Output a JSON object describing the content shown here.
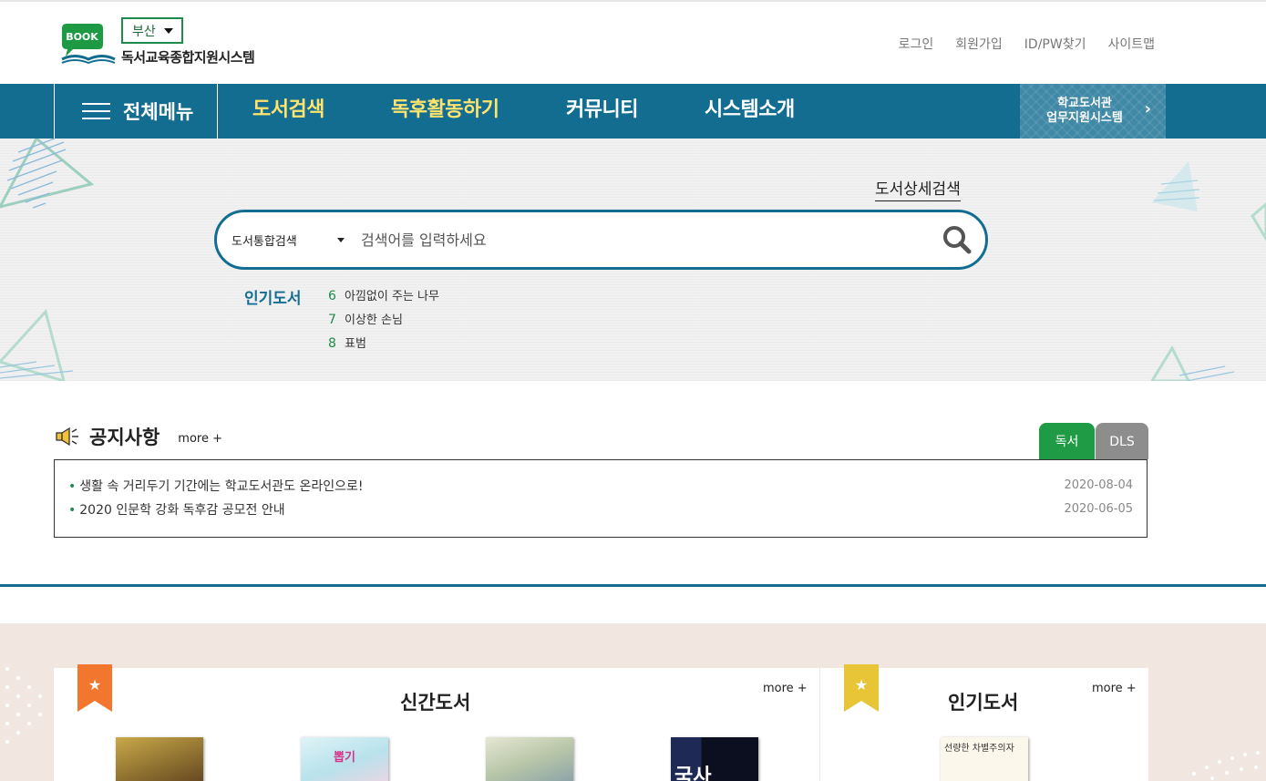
{
  "header": {
    "logo_text": "BOOK",
    "region": "부산",
    "site_name": "독서교육종합지원시스템",
    "links": [
      "로그인",
      "회원가입",
      "ID/PW찾기",
      "사이트맵"
    ]
  },
  "gnb": {
    "all_menu": "전체메뉴",
    "items": [
      "도서검색",
      "독후활동하기",
      "커뮤니티",
      "시스템소개"
    ],
    "school_link": [
      "학교도서관",
      "업무지원시스템"
    ]
  },
  "search": {
    "detail_link": "도서상세검색",
    "scope": "도서통합검색",
    "placeholder": "검색어를 입력하세요",
    "popular_title": "인기도서",
    "popular": [
      {
        "rank": "6",
        "title": "아낌없이 주는 나무"
      },
      {
        "rank": "7",
        "title": "이상한 손님"
      },
      {
        "rank": "8",
        "title": "표범"
      }
    ]
  },
  "notice": {
    "title": "공지사항",
    "more": "more +",
    "tabs": [
      "독서",
      "DLS"
    ],
    "items": [
      {
        "title": "생활 속 거리두기 기간에는 학교도서관도 온라인으로!",
        "date": "2020-08-04"
      },
      {
        "title": "2020 인문학 강화 독후감 공모전 안내",
        "date": "2020-06-05"
      }
    ]
  },
  "books": {
    "new_title": "신간도서",
    "popular_title": "인기도서",
    "more": "more +",
    "new_covers": [
      "cover-1",
      "cover-2",
      "cover-3",
      "cover-4"
    ],
    "popular_cover_text": "선량한 차별주의자"
  },
  "colors": {
    "primary": "#136d90",
    "green": "#1e8a4b",
    "highlight": "#ffe36e",
    "orange": "#f2762e",
    "yellow": "#e8c437"
  }
}
